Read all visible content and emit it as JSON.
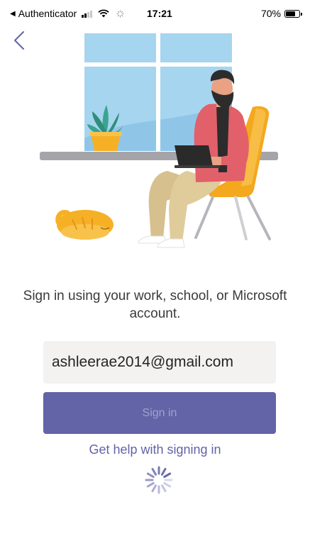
{
  "status_bar": {
    "back_app": "Authenticator",
    "time": "17:21",
    "battery_percent": "70%",
    "battery_level": 0.7,
    "signal_bars_active": 2
  },
  "icons": {
    "back": "chevron-left-icon",
    "spinner": "loading-spinner-icon"
  },
  "signin": {
    "prompt": "Sign in using your work, school, or Microsoft account.",
    "email_value": "ashleerae2014@gmail.com",
    "button_label": "Sign in",
    "help_link": "Get help with signing in"
  },
  "colors": {
    "accent": "#6264a7",
    "button_text_disabled": "#a0a1cc",
    "field_background": "#f3f2f1"
  }
}
